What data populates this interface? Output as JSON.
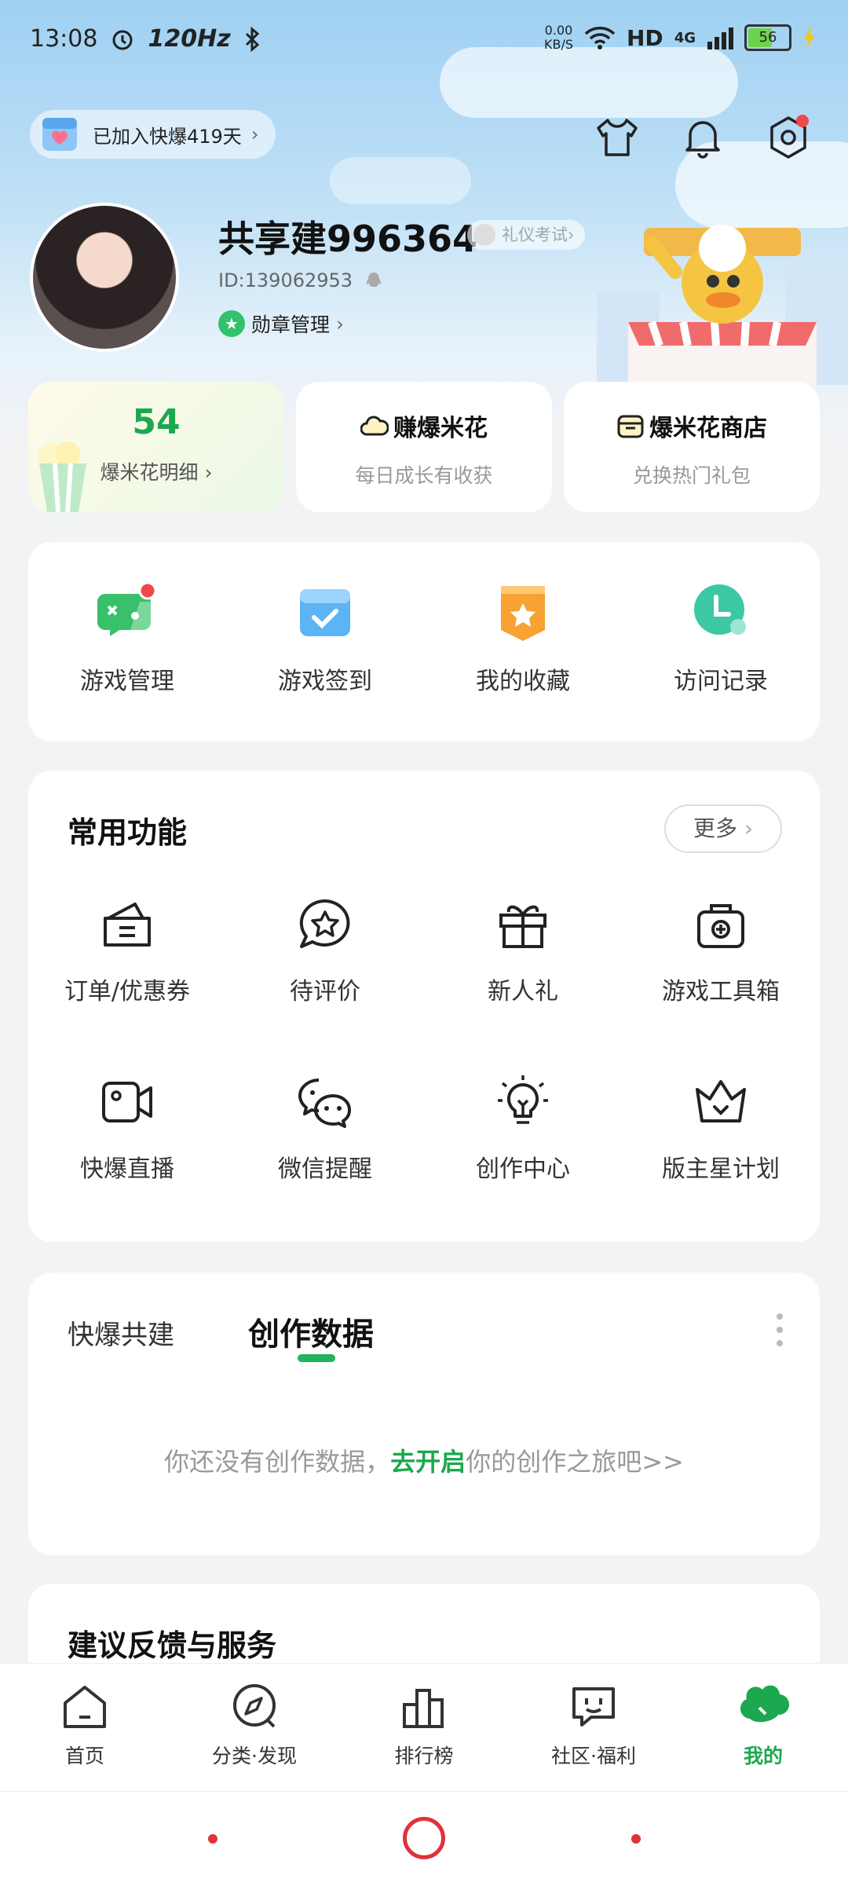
{
  "status_bar": {
    "time": "13:08",
    "refresh": "120Hz",
    "net_speed_value": "0.00",
    "net_speed_unit": "KB/S",
    "hd": "HD",
    "network": "4G",
    "battery": "56"
  },
  "header": {
    "joined_text": "已加入快爆419天",
    "chevron": "›"
  },
  "profile": {
    "username": "共享建996364",
    "etiquette_badge": "礼仪考试›",
    "id_text": "ID:139062953",
    "medal_label": "勋章管理",
    "medal_chevron": "›"
  },
  "stats": {
    "popcorn_count": "54",
    "popcorn_detail": "爆米花明细 ›",
    "earn_title": "赚爆米花",
    "earn_sub": "每日成长有收获",
    "shop_title": "爆米花商店",
    "shop_sub": "兑换热门礼包"
  },
  "quick_actions": [
    {
      "label": "游戏管理",
      "icon": "gamepad-icon"
    },
    {
      "label": "游戏签到",
      "icon": "checkin-icon"
    },
    {
      "label": "我的收藏",
      "icon": "favorite-icon"
    },
    {
      "label": "访问记录",
      "icon": "history-icon"
    }
  ],
  "common_functions": {
    "title": "常用功能",
    "more": "更多",
    "more_chevron": "›",
    "items": [
      {
        "label": "订单/优惠券",
        "icon": "wallet-icon"
      },
      {
        "label": "待评价",
        "icon": "review-icon"
      },
      {
        "label": "新人礼",
        "icon": "gift-icon"
      },
      {
        "label": "游戏工具箱",
        "icon": "toolbox-icon"
      },
      {
        "label": "快爆直播",
        "icon": "live-icon"
      },
      {
        "label": "微信提醒",
        "icon": "wechat-icon"
      },
      {
        "label": "创作中心",
        "icon": "bulb-icon"
      },
      {
        "label": "版主星计划",
        "icon": "crown-icon"
      }
    ]
  },
  "creator": {
    "tab_cobuild": "快爆共建",
    "tab_data": "创作数据",
    "empty_prefix": "你还没有创作数据，",
    "empty_link": "去开启",
    "empty_suffix": "你的创作之旅吧>>"
  },
  "feedback": {
    "title": "建议反馈与服务"
  },
  "tabbar": [
    {
      "label": "首页",
      "icon": "home-icon"
    },
    {
      "label": "分类·发现",
      "icon": "compass-icon"
    },
    {
      "label": "排行榜",
      "icon": "ranking-icon"
    },
    {
      "label": "社区·福利",
      "icon": "community-icon"
    },
    {
      "label": "我的",
      "icon": "mine-icon"
    }
  ],
  "colors": {
    "accent": "#1ca84e",
    "nav": "#e0323a"
  }
}
